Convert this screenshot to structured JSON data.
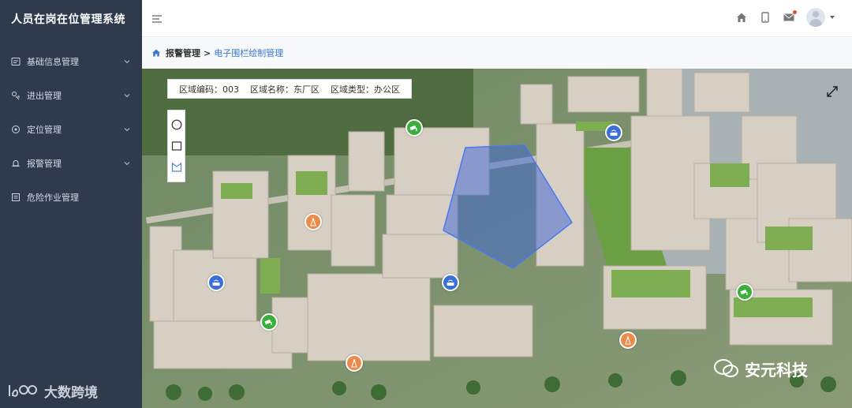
{
  "app": {
    "title": "人员在岗在位管理系统"
  },
  "sidebar": {
    "items": [
      {
        "label": "基础信息管理",
        "icon": "database-icon",
        "has_children": true
      },
      {
        "label": "进出管理",
        "icon": "entry-exit-icon",
        "has_children": true
      },
      {
        "label": "定位管理",
        "icon": "location-icon",
        "has_children": true
      },
      {
        "label": "报警管理",
        "icon": "alarm-bell-icon",
        "has_children": true
      },
      {
        "label": "危险作业管理",
        "icon": "hazard-work-icon",
        "has_children": false
      }
    ]
  },
  "header": {
    "icons": [
      "menu-toggle-icon",
      "home-icon",
      "tablet-icon",
      "mail-icon",
      "user-avatar"
    ]
  },
  "breadcrumb": {
    "items": [
      "报警管理",
      "电子围栏绘制管理"
    ],
    "separator": ">"
  },
  "region_info": {
    "code": "区域编码：003",
    "name": "区域名称：东厂区",
    "type": "区域类型：办公区"
  },
  "draw_tools": [
    "circle-tool-icon",
    "rectangle-tool-icon",
    "polygon-tool-icon"
  ],
  "colors": {
    "sidebar_bg": "#2f3a4c",
    "accent_blue": "#3a78c9",
    "fence_fill": "#3a64d8",
    "camera_marker": "#3cae3c",
    "router_marker": "#3a6fd8",
    "tower_marker": "#ec8a4a"
  },
  "markers": [
    {
      "type": "camera"
    },
    {
      "type": "camera"
    },
    {
      "type": "camera"
    },
    {
      "type": "router"
    },
    {
      "type": "router"
    },
    {
      "type": "router"
    },
    {
      "type": "tower"
    },
    {
      "type": "tower"
    },
    {
      "type": "tower"
    }
  ],
  "watermarks": {
    "left": "大数跨境",
    "right": "安元科技"
  }
}
